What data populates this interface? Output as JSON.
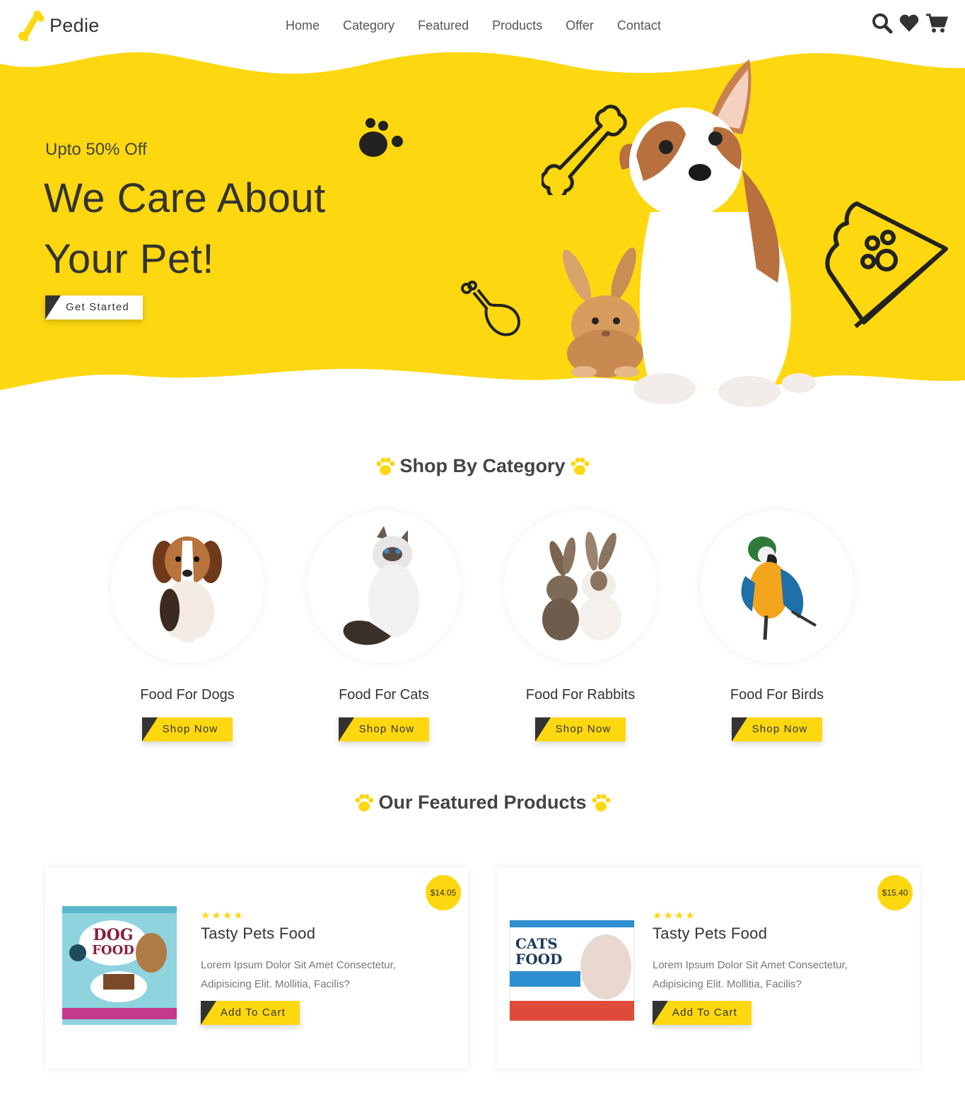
{
  "brand": {
    "name": "Pedie",
    "accent": "#fdd710",
    "dark": "#333333"
  },
  "nav": {
    "items": [
      {
        "label": "Home"
      },
      {
        "label": "Category"
      },
      {
        "label": "Featured"
      },
      {
        "label": "Products"
      },
      {
        "label": "Offer"
      },
      {
        "label": "Contact"
      }
    ]
  },
  "header_icons": [
    "search-icon",
    "heart-icon",
    "cart-icon"
  ],
  "hero": {
    "subtitle": "Upto 50% Off",
    "title_line1": "We Care About",
    "title_line2": "Your Pet!",
    "cta": "Get Started"
  },
  "categories": {
    "title": "Shop By Category",
    "items": [
      {
        "name": "Food For Dogs",
        "button": "Shop Now"
      },
      {
        "name": "Food For Cats",
        "button": "Shop Now"
      },
      {
        "name": "Food For Rabbits",
        "button": "Shop Now"
      },
      {
        "name": "Food For Birds",
        "button": "Shop Now"
      }
    ]
  },
  "featured": {
    "title": "Our Featured Products",
    "products": [
      {
        "price": "$14.05",
        "rating": 4,
        "name": "Tasty Pets Food",
        "description": "Lorem Ipsum Dolor Sit Amet Consectetur, Adipisicing Elit. Mollitia, Facilis?",
        "button": "Add To Cart",
        "box_line1": "DOG",
        "box_line2": "FOOD"
      },
      {
        "price": "$15.40",
        "rating": 4,
        "name": "Tasty Pets Food",
        "description": "Lorem Ipsum Dolor Sit Amet Consectetur, Adipisicing Elit. Mollitia, Facilis?",
        "button": "Add To Cart",
        "box_line1": "CATS",
        "box_line2": "FOOD"
      }
    ]
  }
}
